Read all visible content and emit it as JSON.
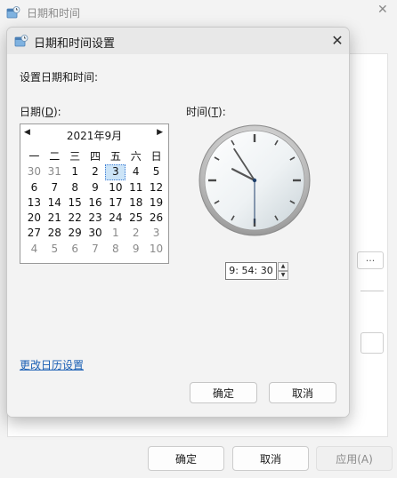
{
  "parent": {
    "title": "日期和时间",
    "close_glyph": "✕",
    "panel_button_label": "...",
    "buttons": {
      "ok": "确定",
      "cancel": "取消",
      "apply": "应用(A)"
    }
  },
  "dialog": {
    "title": "日期和时间设置",
    "close_glyph": "✕",
    "heading": "设置日期和时间:",
    "date_label": "日期(D):",
    "date_label_parts": {
      "before": "日期(",
      "accel": "D",
      "after": "):"
    },
    "time_label_parts": {
      "before": "时间(",
      "accel": "T",
      "after": "):"
    },
    "calendar": {
      "month_title": "2021年9月",
      "prev_glyph": "◀",
      "next_glyph": "▶",
      "weekdays": [
        "一",
        "二",
        "三",
        "四",
        "五",
        "六",
        "日"
      ],
      "days": [
        [
          "30",
          "31",
          "1",
          "2",
          "3",
          "4",
          "5"
        ],
        [
          "6",
          "7",
          "8",
          "9",
          "10",
          "11",
          "12"
        ],
        [
          "13",
          "14",
          "15",
          "16",
          "17",
          "18",
          "19"
        ],
        [
          "20",
          "21",
          "22",
          "23",
          "24",
          "25",
          "26"
        ],
        [
          "27",
          "28",
          "29",
          "30",
          "1",
          "2",
          "3"
        ],
        [
          "4",
          "5",
          "6",
          "7",
          "8",
          "9",
          "10"
        ]
      ],
      "other_month": [
        [
          true,
          true,
          false,
          false,
          false,
          false,
          false
        ],
        [
          false,
          false,
          false,
          false,
          false,
          false,
          false
        ],
        [
          false,
          false,
          false,
          false,
          false,
          false,
          false
        ],
        [
          false,
          false,
          false,
          false,
          false,
          false,
          false
        ],
        [
          false,
          false,
          false,
          false,
          true,
          true,
          true
        ],
        [
          true,
          true,
          true,
          true,
          true,
          true,
          true
        ]
      ],
      "selected_day": "3"
    },
    "time": {
      "value": "9: 54: 30",
      "hours": 9,
      "minutes": 54,
      "seconds": 30,
      "spin_up": "▲",
      "spin_down": "▼"
    },
    "change_calendar_link": "更改日历设置",
    "buttons": {
      "ok": "确定",
      "cancel": "取消"
    }
  }
}
